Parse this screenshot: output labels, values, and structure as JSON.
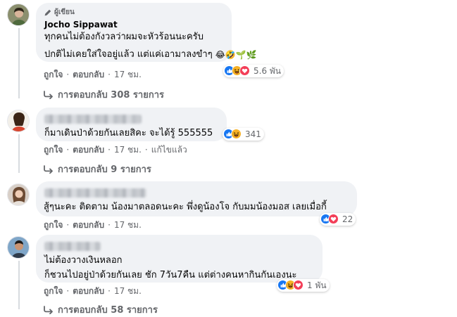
{
  "comments": [
    {
      "badge": "ผู้เขียน",
      "name": "Jocho Sippawat",
      "line1": "ทุกคนไม่ต้องกังวลว่าผมจะหัวร้อนนะครับ",
      "line2": "ปกติไม่เคยใส่ใจอยู่แล้ว แต่แค่เอามาลงขำๆ",
      "emoji": "😂🤣🌱🌿",
      "like": "ถูกใจ",
      "reply": "ตอบกลับ",
      "time": "17 ชม.",
      "reaction_count": "5.6 พัน",
      "replies": "การตอบกลับ 308 รายการ"
    },
    {
      "line1": "ก็มาเดินป่าด้วยกันเลยสิคะ จะได้รู้ 555555",
      "like": "ถูกใจ",
      "reply": "ตอบกลับ",
      "time": "17 ชม.",
      "edited": "แก้ไขแล้ว",
      "reaction_count": "341",
      "replies": "การตอบกลับ 9 รายการ"
    },
    {
      "line1": "สู้ๆนะคะ ติดตาม น้องมาตลอดนะคะ พึ่งดูน้องโจ กับมมน้องมอส เลยเมื่อกี้",
      "like": "ถูกใจ",
      "reply": "ตอบกลับ",
      "time": "17 ชม.",
      "reaction_count": "22"
    },
    {
      "line1": "ไม่ต้องวางเงินหลอก",
      "line2": "ก็ชวนไปอยู่ป่าด้วยกันเลย ชัก 7วัน7คืน แต่ต่างคนหากินกันเองนะ",
      "like": "ถูกใจ",
      "reply": "ตอบกลับ",
      "time": "17 ชม.",
      "reaction_count": "1 พัน",
      "replies": "การตอบกลับ 58 รายการ"
    }
  ],
  "colors": {
    "like_blue": "#1877f2",
    "love_red": "#f33e58",
    "haha_yellow": "#f7b125",
    "meta_gray": "#65676b",
    "bubble_bg": "#f0f2f5"
  }
}
